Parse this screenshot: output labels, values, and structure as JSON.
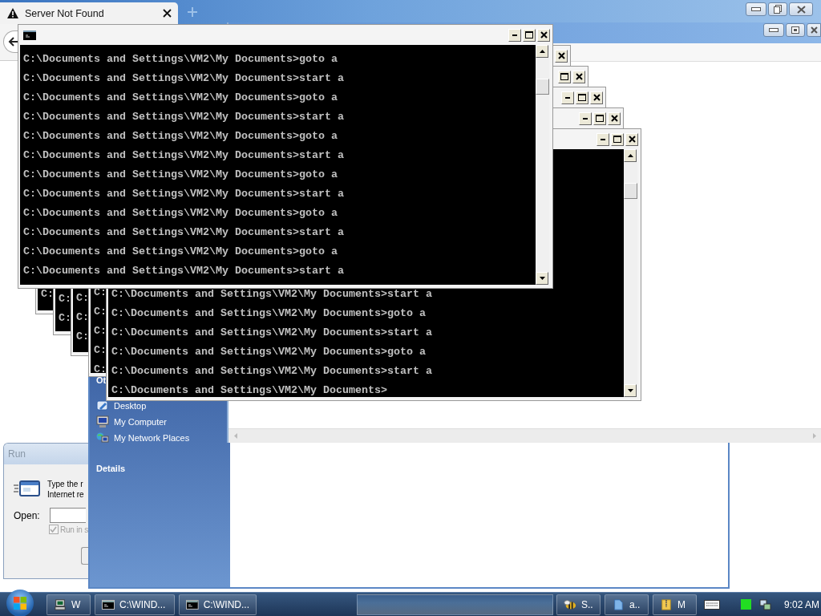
{
  "browser": {
    "tab_title": "Server Not Found"
  },
  "explorer": {
    "sections": [
      {
        "title": "Ot",
        "items": [
          {
            "label": "Desktop"
          },
          {
            "label": "My Computer"
          },
          {
            "label": "My Network Places"
          }
        ]
      },
      {
        "title": "Details"
      }
    ]
  },
  "run_dialog": {
    "title": "Run",
    "text_lines": [
      "Type the r",
      "Internet re"
    ],
    "open_label": "Open:",
    "checkbox": {
      "label": "Run in s",
      "checked": true,
      "disabled": true
    }
  },
  "cmd_windows": [
    {
      "title_icon": true,
      "title_buttons": [
        {
          "kind": "minimize"
        },
        {
          "kind": "maximize"
        },
        {
          "kind": "close"
        }
      ],
      "scrollbar": true,
      "lines": [
        "C:\\Documents and Settings\\VM2\\My Documents>goto a",
        "C:\\Documents and Settings\\VM2\\My Documents>start a",
        "C:\\Documents and Settings\\VM2\\My Documents>goto a",
        "C:\\Documents and Settings\\VM2\\My Documents>start a",
        "C:\\Documents and Settings\\VM2\\My Documents>goto a",
        "C:\\Documents and Settings\\VM2\\My Documents>start a",
        "C:\\Documents and Settings\\VM2\\My Documents>goto a",
        "C:\\Documents and Settings\\VM2\\My Documents>start a",
        "C:\\Documents and Settings\\VM2\\My Documents>goto a",
        "C:\\Documents and Settings\\VM2\\My Documents>start a",
        "C:\\Documents and Settings\\VM2\\My Documents>goto a",
        "C:\\Documents and Settings\\VM2\\My Documents>start a"
      ]
    },
    {
      "title_buttons": [
        {
          "kind": "close"
        }
      ],
      "lines": [
        "C:"
      ]
    },
    {
      "title_buttons": [
        {
          "kind": "maximize"
        },
        {
          "kind": "close"
        }
      ],
      "lines": [
        "C:",
        "C:"
      ]
    },
    {
      "title_buttons": [
        {
          "kind": "minimize"
        },
        {
          "kind": "maximize"
        },
        {
          "kind": "close"
        }
      ],
      "lines": [
        "C:",
        "C:",
        "C:"
      ]
    },
    {
      "title_buttons": [
        {
          "kind": "minimize"
        },
        {
          "kind": "maximize"
        },
        {
          "kind": "close"
        }
      ],
      "lines": [
        "C:",
        "C:",
        "C:",
        "C:",
        "C:"
      ]
    },
    {
      "title_buttons": [
        {
          "kind": "minimize"
        },
        {
          "kind": "maximize"
        },
        {
          "kind": "close"
        }
      ],
      "scrollbar": true,
      "lines": [
        "C:\\Documents and Settings\\VM2\\My Documents>start a",
        "C:\\Documents and Settings\\VM2\\My Documents>goto a",
        "C:\\Documents and Settings\\VM2\\My Documents>start a",
        "C:\\Documents and Settings\\VM2\\My Documents>goto a",
        "C:\\Documents and Settings\\VM2\\My Documents>start a",
        "C:\\Documents and Settings\\VM2\\My Documents>"
      ]
    }
  ],
  "taskbar": {
    "left_buttons": [
      {
        "label": "W"
      },
      {
        "label": "C:\\WIND..."
      },
      {
        "label": "C:\\WIND..."
      }
    ],
    "right_buttons": [
      {
        "label": "S.."
      },
      {
        "label": "a.."
      },
      {
        "label": "M"
      }
    ],
    "clock": "9:02 AM"
  }
}
